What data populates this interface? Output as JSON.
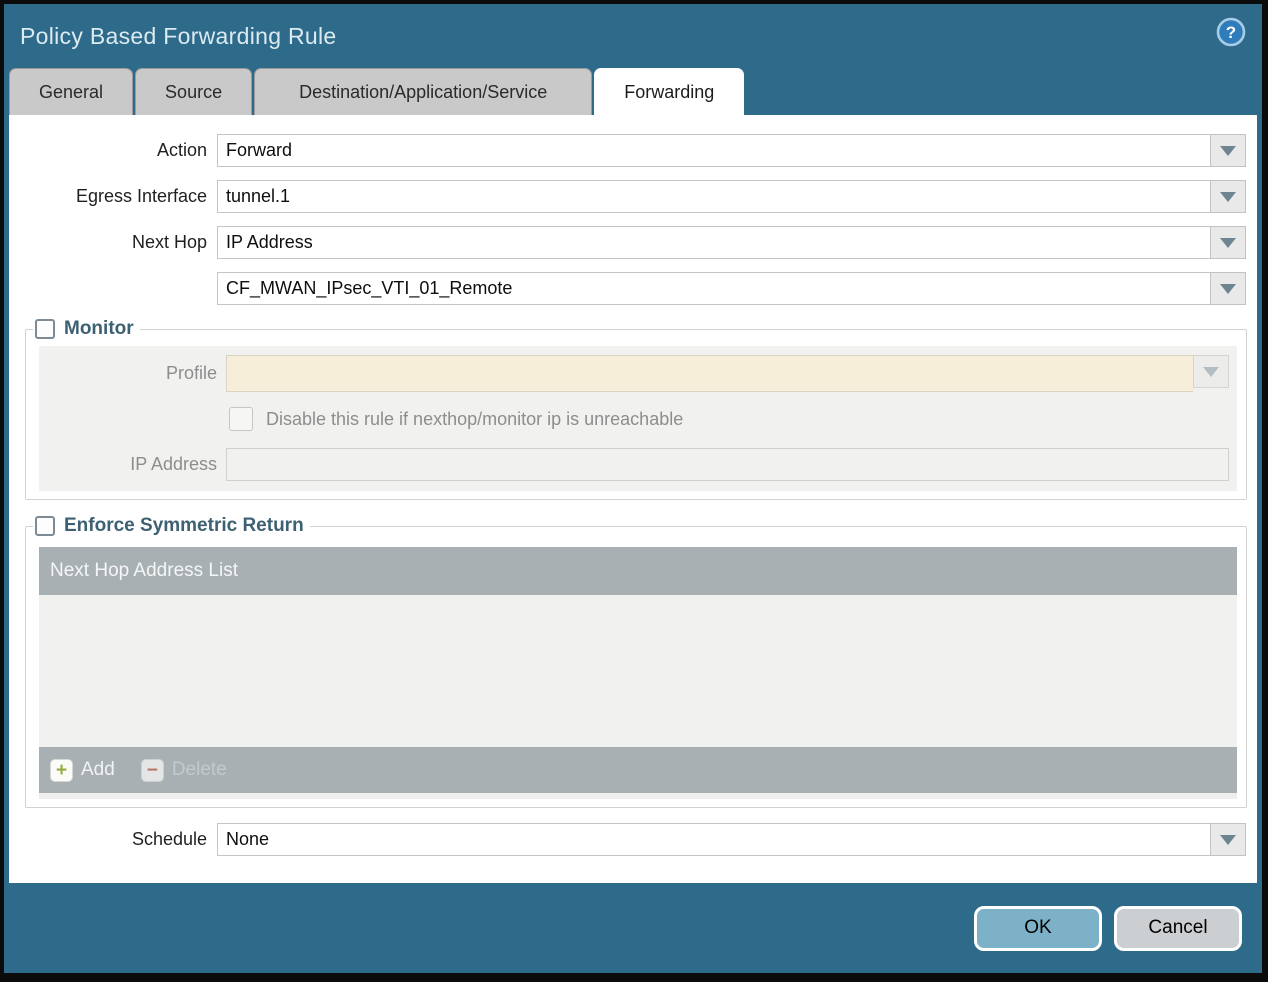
{
  "dialog": {
    "title": "Policy Based Forwarding Rule"
  },
  "tabs": [
    {
      "label": "General"
    },
    {
      "label": "Source"
    },
    {
      "label": "Destination/Application/Service"
    },
    {
      "label": "Forwarding"
    }
  ],
  "active_tab": "Forwarding",
  "form": {
    "action": {
      "label": "Action",
      "value": "Forward"
    },
    "egress_interface": {
      "label": "Egress Interface",
      "value": "tunnel.1"
    },
    "next_hop": {
      "label": "Next Hop",
      "value": "IP Address"
    },
    "next_hop_address": {
      "value": "CF_MWAN_IPsec_VTI_01_Remote"
    },
    "schedule": {
      "label": "Schedule",
      "value": "None"
    }
  },
  "monitor": {
    "legend": "Monitor",
    "checked": false,
    "profile_label": "Profile",
    "profile_value": "",
    "disable_rule_label": "Disable this rule if nexthop/monitor ip is unreachable",
    "disable_rule_checked": false,
    "ip_address_label": "IP Address",
    "ip_address_value": ""
  },
  "symmetric_return": {
    "legend": "Enforce Symmetric Return",
    "checked": false,
    "table_header": "Next Hop Address List",
    "rows": [],
    "add_label": "Add",
    "delete_label": "Delete",
    "delete_enabled": false
  },
  "footer": {
    "ok_label": "OK",
    "cancel_label": "Cancel"
  },
  "icons": {
    "help": "question-mark-circle",
    "dropdown": "chevron-down",
    "add": "+",
    "delete": "−"
  },
  "colors": {
    "chrome_teal": "#2e6b8a",
    "active_tab_bg": "#ffffff",
    "inactive_tab_bg": "#c9c9c9",
    "readonly_field_bg": "#f6eed9",
    "section_bg": "#f1f1ef",
    "table_chrome": "#a9b0b4",
    "ok_button": "#7db1c7",
    "cancel_button": "#cbcfd1",
    "legend_text": "#3d6173",
    "add_icon_green": "#93ad3c",
    "delete_icon_red": "#b57768"
  }
}
